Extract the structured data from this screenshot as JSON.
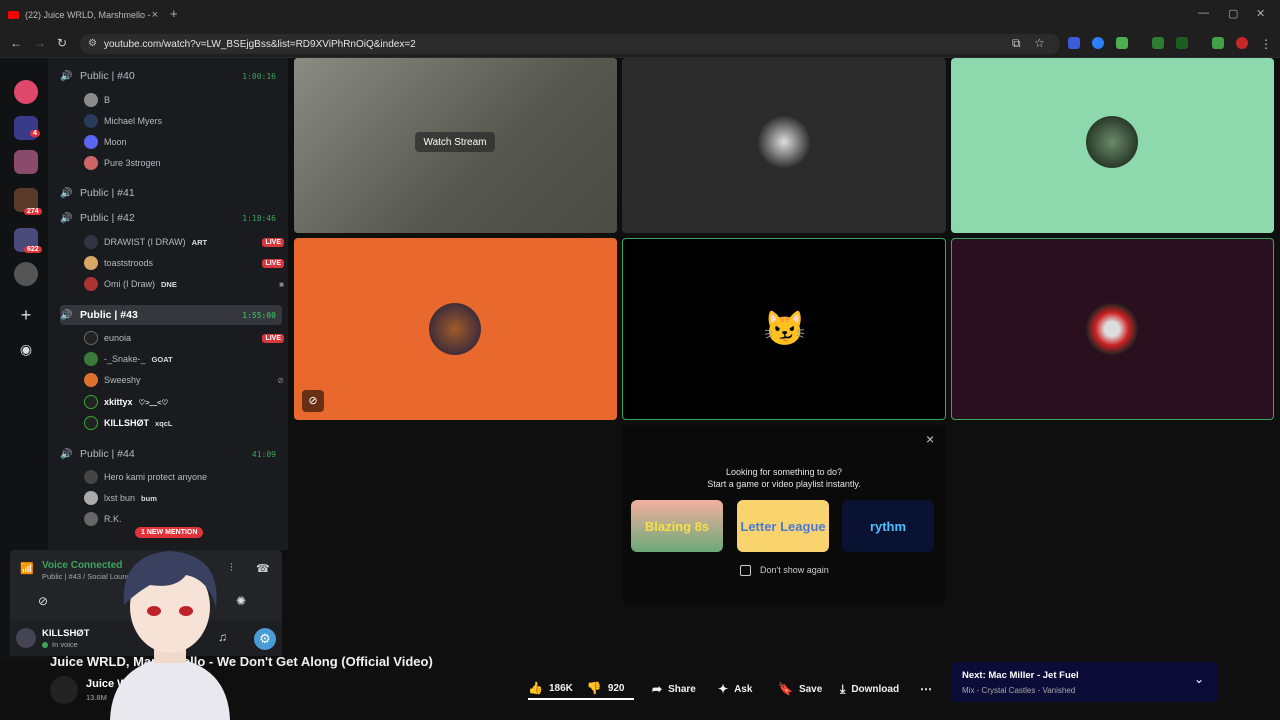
{
  "browser": {
    "tab_title": "(22) Juice WRLD, Marshmello -",
    "tab_close": "×",
    "new_tab": "+",
    "url": "youtube.com/watch?v=LW_BSEjgBss&list=RD9XViPhRnOiQ&index=2"
  },
  "servers": {
    "badges": [
      "4",
      "274",
      "622"
    ]
  },
  "channels": [
    {
      "name": "Public | #40",
      "time": "1:00:16",
      "active": false
    },
    {
      "name": "Public | #41",
      "time": "",
      "active": false
    },
    {
      "name": "Public | #42",
      "time": "1:18:46",
      "active": false
    },
    {
      "name": "Public | #43",
      "time": "1:55:00",
      "active": true
    },
    {
      "name": "Public | #44",
      "time": "41:09",
      "active": false
    }
  ],
  "users": {
    "c40": [
      {
        "name": "B",
        "tag": "",
        "color": "#8b8b8b"
      },
      {
        "name": "Michael Myers",
        "tag": "",
        "color": "#2a3a5a"
      },
      {
        "name": "Moon",
        "tag": "",
        "color": "#5865f2"
      },
      {
        "name": "Pure 3strogen",
        "tag": "",
        "color": "#c66"
      }
    ],
    "c42": [
      {
        "name": "DRAWIST (I DRAW)",
        "tag": "ART",
        "color": "#334",
        "status": "LIVE"
      },
      {
        "name": "toaststroods",
        "tag": "",
        "color": "#d9a866",
        "status": "LIVE"
      },
      {
        "name": "Omi (I Draw)",
        "tag": "DNE",
        "color": "#a33",
        "status": ""
      }
    ],
    "c43": [
      {
        "name": "eunoia",
        "tag": "",
        "color": "#222",
        "status": "LIVE"
      },
      {
        "name": "-_Snake-_",
        "tag": "GOAT",
        "color": "#3a7a3a",
        "status": ""
      },
      {
        "name": "Sweeshy",
        "tag": "",
        "color": "#e07030",
        "status": ""
      },
      {
        "name": "xkittyx",
        "tag": "♡>﹏<♡",
        "color": "#3a3",
        "status": ""
      },
      {
        "name": "KILLSHØT",
        "tag": "xqcL",
        "color": "#222",
        "status": ""
      }
    ],
    "c44": [
      {
        "name": "Hero kami protect anyone",
        "tag": "",
        "color": "#444"
      },
      {
        "name": "lxst bun",
        "tag": "bum",
        "color": "#aaa"
      },
      {
        "name": "R.K.",
        "tag": "",
        "color": "#666"
      }
    ]
  },
  "mention": "1 NEW MENTION",
  "voice": {
    "title": "Voice Connected",
    "sub": "Public | #43 / Social Lounge"
  },
  "user_panel": {
    "name": "KILLSHØT",
    "status": "In voice"
  },
  "stream": {
    "watch_label": "Watch Stream"
  },
  "activity": {
    "line1": "Looking for something to do?",
    "line2": "Start a game or video playlist instantly.",
    "close": "×",
    "cards": [
      "Blazing 8s",
      "Letter League",
      "rythm"
    ],
    "dont_show": "Don't show again"
  },
  "youtube": {
    "title": "Juice WRLD, Marshmello - We Don't Get Along (Official Video)",
    "channel": "Juice WRLD",
    "subs": "13.8M",
    "likes": "186K",
    "dislikes": "920",
    "share": "Share",
    "ask": "Ask",
    "save": "Save",
    "download": "Download",
    "next_title": "Next: Mac Miller - Jet Fuel",
    "next_sub": "Mix - Crystal Castles - Vanished"
  }
}
